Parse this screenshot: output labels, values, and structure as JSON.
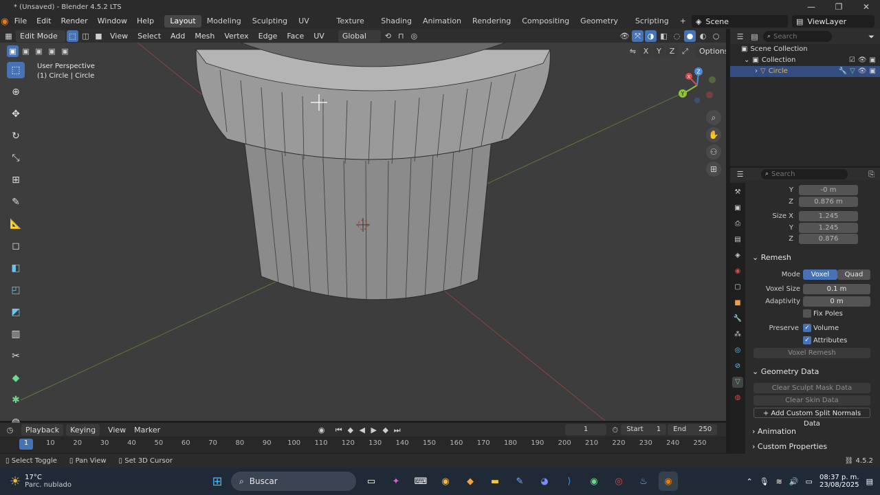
{
  "window": {
    "title": "* (Unsaved) - Blender 4.5.2 LTS",
    "min": "—",
    "max": "❐",
    "close": "✕"
  },
  "menu": [
    "File",
    "Edit",
    "Render",
    "Window",
    "Help"
  ],
  "workspaces": [
    "Layout",
    "Modeling",
    "Sculpting",
    "UV Editing",
    "Texture Paint",
    "Shading",
    "Animation",
    "Rendering",
    "Compositing",
    "Geometry Nodes",
    "Scripting"
  ],
  "scene": {
    "name": "Scene",
    "viewlayer": "ViewLayer"
  },
  "viewport_header": {
    "mode": "Edit Mode",
    "menus": [
      "View",
      "Select",
      "Add",
      "Mesh",
      "Vertex",
      "Edge",
      "Face",
      "UV"
    ],
    "orientation": "Global",
    "options": "Options",
    "axes": [
      "X",
      "Y",
      "Z"
    ]
  },
  "overlay": {
    "perspective": "User Perspective",
    "object": "(1) Circle | Circle"
  },
  "gizmo": {
    "x": "X",
    "y": "Y",
    "z": "Z"
  },
  "outliner": {
    "search_placeholder": "Search",
    "scene_collection": "Scene Collection",
    "collection": "Collection",
    "object": "Circle"
  },
  "properties": {
    "search_placeholder": "Search",
    "dims": [
      {
        "label": "Y",
        "value": "-0 m"
      },
      {
        "label": "Z",
        "value": "0.876 m"
      },
      {
        "label": "Size X",
        "value": "1.245"
      },
      {
        "label": "Y",
        "value": "1.245"
      },
      {
        "label": "Z",
        "value": "0.876"
      }
    ],
    "remesh": {
      "title": "Remesh",
      "mode_label": "Mode",
      "mode_voxel": "Voxel",
      "mode_quad": "Quad",
      "voxel_size_label": "Voxel Size",
      "voxel_size": "0.1 m",
      "adaptivity_label": "Adaptivity",
      "adaptivity": "0 m",
      "fix_poles": "Fix Poles",
      "preserve_label": "Preserve",
      "volume": "Volume",
      "attributes": "Attributes",
      "button": "Voxel Remesh"
    },
    "geometry": {
      "title": "Geometry Data",
      "clear_sculpt": "Clear Sculpt Mask Data",
      "clear_skin": "Clear Skin Data",
      "add_normals": "Add Custom Split Normals Data"
    },
    "animation": "Animation",
    "custom": "Custom Properties"
  },
  "timeline": {
    "menus": [
      "Playback",
      "Keying",
      "View",
      "Marker"
    ],
    "current": "1",
    "start_label": "Start",
    "start": "1",
    "end_label": "End",
    "end": "250",
    "ticks": [
      "1",
      "10",
      "20",
      "30",
      "40",
      "50",
      "60",
      "70",
      "80",
      "90",
      "100",
      "110",
      "120",
      "130",
      "140",
      "150",
      "160",
      "170",
      "180",
      "190",
      "200",
      "210",
      "220",
      "230",
      "240",
      "250"
    ]
  },
  "status": {
    "items": [
      "Select Toggle",
      "Pan View",
      "Set 3D Cursor"
    ],
    "version": "4.5.2"
  },
  "taskbar": {
    "temp": "17°C",
    "weather": "Parc. nublado",
    "search": "Buscar",
    "time": "08:37 p. m.",
    "date": "23/08/2025"
  }
}
